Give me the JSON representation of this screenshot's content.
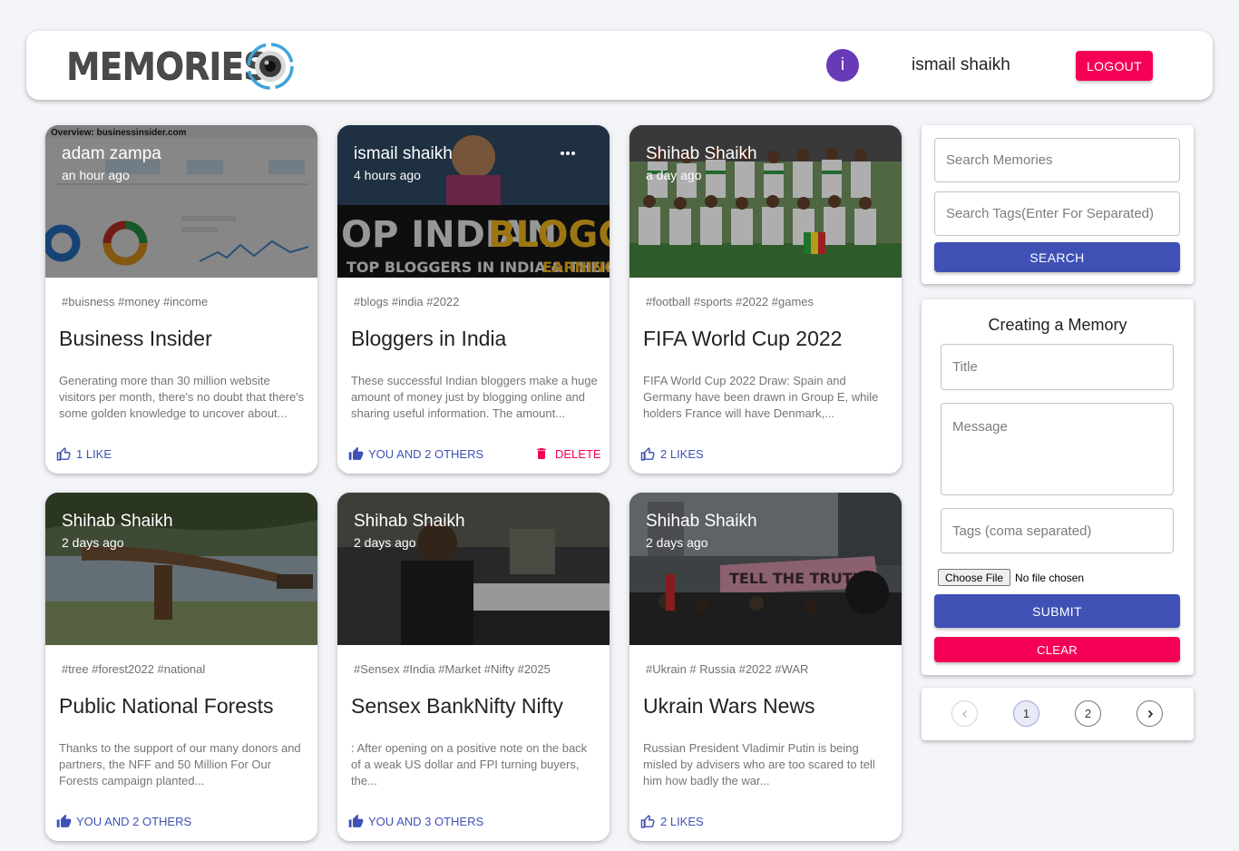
{
  "header": {
    "brand": "MEMORIES",
    "user_initial": "i",
    "user_name": "ismail shaikh",
    "logout_label": "LOGOUT"
  },
  "posts": [
    {
      "creator": "adam zampa",
      "time": "an hour ago",
      "tags": "#buisness #money #income",
      "title": "Business Insider",
      "message": "Generating more than 30 million website visitors per month, there's no doubt that there's some golden knowledge to uncover about...",
      "likes": "1 LIKE",
      "image_caption": "Overview: businessinsider.com"
    },
    {
      "creator": "ismail shaikh",
      "time": "4 hours ago",
      "tags": "#blogs #india #2022",
      "title": "Bloggers in India",
      "message": "These successful Indian bloggers make a huge amount of money just by blogging online and sharing useful information. The amount...",
      "likes": "YOU AND 2 OTHERS",
      "delete_label": "DELETE",
      "image_banner_1": "OP INDIAN",
      "image_banner_2": "BLOGGE",
      "image_banner_3": "TOP BLOGGERS IN INDIA & THEIR",
      "image_banner_4": "EARNINGS"
    },
    {
      "creator": "Shihab Shaikh",
      "time": "a day ago",
      "tags": "#football #sports #2022 #games",
      "title": "FIFA World Cup 2022",
      "message": "FIFA World Cup 2022 Draw: Spain and Germany have been drawn in Group E, while holders France will have Denmark,...",
      "likes": "2 LIKES"
    },
    {
      "creator": "Shihab Shaikh",
      "time": "2 days ago",
      "tags": "#tree #forest2022 #national",
      "title": "Public National Forests",
      "message": "Thanks to the support of our many donors and partners, the NFF and 50 Million For Our Forests campaign planted...",
      "likes": "YOU AND 2 OTHERS"
    },
    {
      "creator": "Shihab Shaikh",
      "time": "2 days ago",
      "tags": "#Sensex #India #Market #Nifty #2025",
      "title": "Sensex BankNifty Nifty",
      "message": ": After opening on a positive note on the back of a weak US dollar and FPI turning buyers, the...",
      "likes": "YOU AND 3 OTHERS"
    },
    {
      "creator": "Shihab Shaikh",
      "time": "2 days ago",
      "tags": "#Ukrain # Russia #2022 #WAR",
      "title": "Ukrain Wars News",
      "message": "Russian President Vladimir Putin is being misled by advisers who are too scared to tell him how badly the war...",
      "likes": "2 LIKES",
      "image_banner": "TELL THE TRUTH"
    }
  ],
  "search": {
    "memories_placeholder": "Search Memories",
    "tags_placeholder": "Search Tags(Enter For Separated)",
    "button_label": "SEARCH"
  },
  "form": {
    "heading": "Creating a Memory",
    "title_placeholder": "Title",
    "message_placeholder": "Message",
    "tags_placeholder": "Tags (coma separated)",
    "choose_file_label": "Choose File",
    "file_status": "No file chosen",
    "submit_label": "SUBMIT",
    "clear_label": "CLEAR"
  },
  "pagination": {
    "pages": [
      "1",
      "2"
    ],
    "current_page": "1"
  },
  "colors": {
    "primary": "#3f51b5",
    "secondary": "#f50057",
    "avatar": "#673ab7",
    "background": "#f4f5f9"
  }
}
